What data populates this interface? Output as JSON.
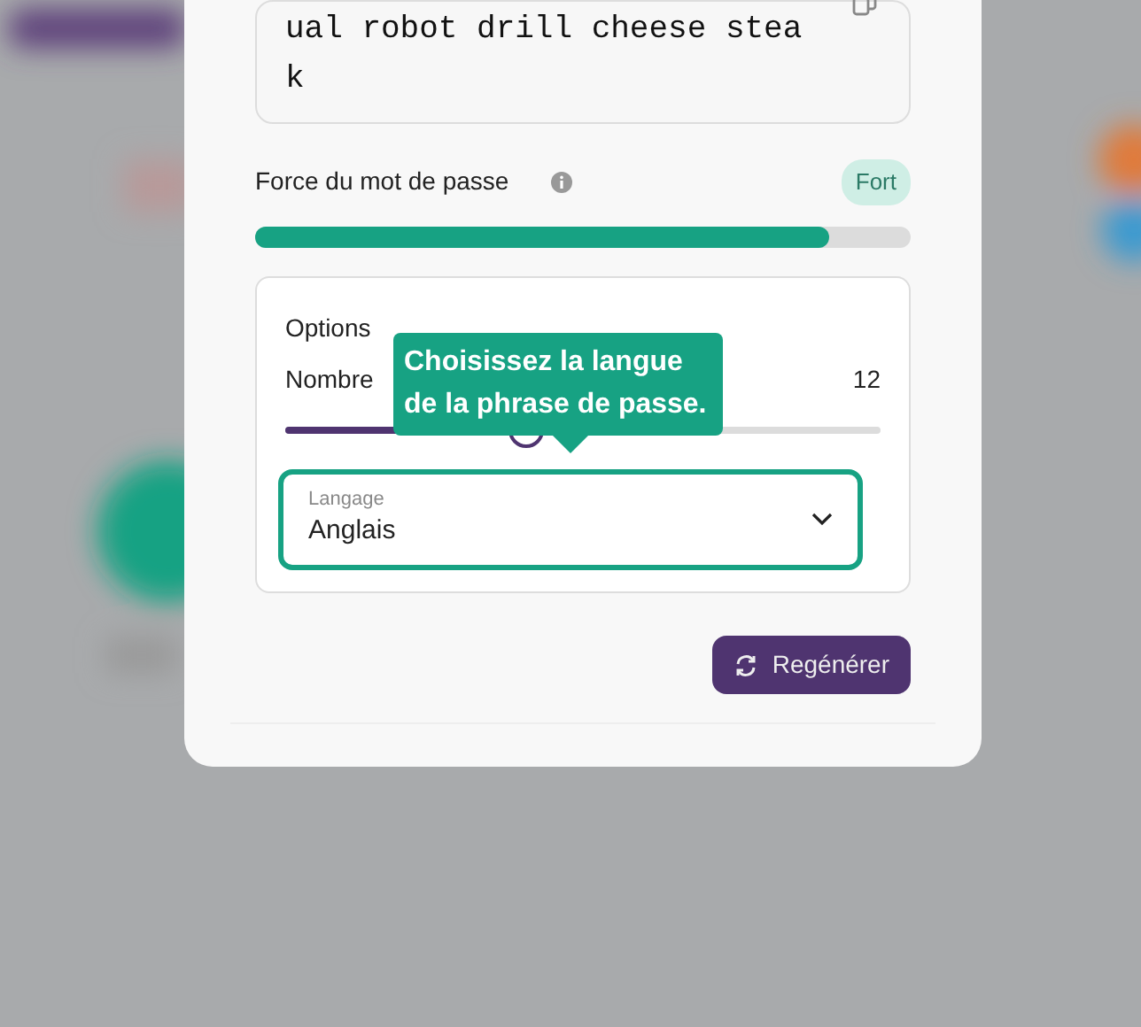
{
  "passphrase": {
    "text": "ual robot drill cheese steak"
  },
  "strength": {
    "label": "Force du mot de passe",
    "badge": "Fort",
    "level": 0.876
  },
  "options": {
    "title": "Options",
    "slider": {
      "label": "Nombre",
      "value": "12",
      "level": 0.405
    },
    "tooltip": "Choisissez la langue de la phrase de passe.",
    "select": {
      "label": "Langage",
      "value": "Anglais",
      "focused": true
    }
  },
  "buttons": [
    {
      "label": "Regénérer"
    }
  ]
}
